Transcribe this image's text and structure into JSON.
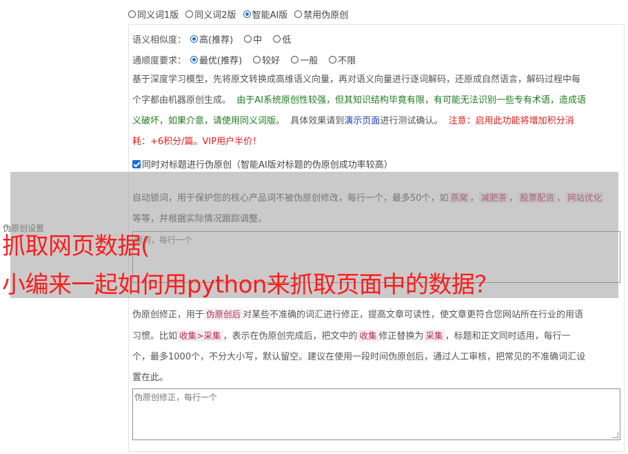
{
  "version_options": [
    {
      "label": "同义词1版",
      "checked": false
    },
    {
      "label": "同义词2版",
      "checked": false
    },
    {
      "label": "智能AI版",
      "checked": true
    },
    {
      "label": "禁用伪原创",
      "checked": false
    }
  ],
  "similarity": {
    "label": "语义相似度：",
    "options": [
      {
        "label": "高(推荐)",
        "checked": true
      },
      {
        "label": "中",
        "checked": false
      },
      {
        "label": "低",
        "checked": false
      }
    ]
  },
  "fluency": {
    "label": "通顺度要求：",
    "options": [
      {
        "label": "最优(推荐)",
        "checked": true
      },
      {
        "label": "较好",
        "checked": false
      },
      {
        "label": "一般",
        "checked": false
      },
      {
        "label": "不限",
        "checked": false
      }
    ]
  },
  "description": {
    "line1": "基于深度学习模型，先将原文转换成高维语义向量，再对语义向量进行逐词解码，还原成自然语言，解码过程中每",
    "line2_a": "个字都由机器原创生成。",
    "line2_green": "由于AI系统原创性较强，但其知识结构毕竟有限，有可能无法识别一些专有术语，造成语",
    "line3_green": "义破坏，如果介意，请使用同义词版。",
    "line3_b": "具体效果请到",
    "line3_link": "演示页面",
    "line3_c": "进行测试确认。",
    "line3_red": "注意：启用此功能将增加积分消",
    "line4_red": "耗：+6积分/篇。VIP用户半价！"
  },
  "title_checkbox": {
    "label": "同时对标题进行伪原创（智能AI版对标题的伪原创成功率较高）",
    "checked": true
  },
  "lock_words": {
    "text_a": "自动锁词，用于保护您的核心产品词不被伪原创修改，每行一个，最多50个，如",
    "tags": [
      "燕窝",
      "减肥茶",
      "股票配资",
      "网站优化"
    ],
    "sep": "，",
    "text_b": "等等，并根据实际情况跟踪调整。",
    "placeholder": "锁词，每行一个"
  },
  "side_label": "伪原创设置",
  "correction": {
    "line1_a": "伪原创修正，用于",
    "line1_tag": "伪原创后",
    "line1_b": "对某些不准确的词汇进行修正，提高文章可读性，使文章更符合您网站所在行业的用语",
    "line2_a": "习惯。比如",
    "line2_tag1": "收集>采集",
    "line2_b": "，表示在伪原创完成后，把文中的",
    "line2_tag2": "收集",
    "line2_c": "修正替换为",
    "line2_tag3": "采集",
    "line2_d": "，标题和正文同时适用，每行一",
    "line3": "个，最多1000个，不分大小写，默认留空。建议在使用一段时间伪原创后，通过人工审核，把常见的不准确词汇设",
    "line4": "置在此。",
    "placeholder": "伪原创修正，每行一个"
  },
  "headline": {
    "line1": "抓取网页数据(",
    "line2": "小编来一起如何用python来抓取页面中的数据？"
  },
  "colors": {
    "accent": "#1a6fd6",
    "headline": "#ff1b1b",
    "green": "#1e7b1e",
    "red": "#e01b1b"
  }
}
